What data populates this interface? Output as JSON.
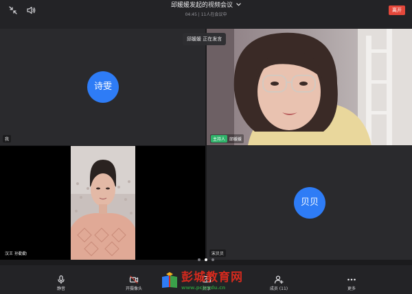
{
  "header": {
    "meeting_title": "邱媛媛发起的视频会议",
    "meeting_subtitle": "04:45 | 11人在会议中",
    "leave_label": "离开",
    "icons": [
      "collapse-icon",
      "speaker-icon",
      "chevron-down-icon"
    ]
  },
  "speaking_indicator": "邱媛媛 正在发言",
  "participants": {
    "me": {
      "avatar_text": "诗雯",
      "name": "我"
    },
    "host": {
      "badge": "主持人",
      "name": "邱媛媛"
    },
    "sunqinqin": {
      "name": "汉王 孙勤勤"
    },
    "songbeibei": {
      "avatar_text": "贝贝",
      "name": "宋贝贝"
    }
  },
  "pagination": {
    "total": 3,
    "current": 2
  },
  "toolbar": {
    "mute_label": "静音",
    "camera_label": "开摄像头",
    "share_label": "共享",
    "members_label": "成员 (11)",
    "more_label": "更多"
  },
  "watermark": {
    "text": "彭城教育网",
    "url": "www.pcjyedu.cn"
  },
  "colors": {
    "accent_blue": "#2e7cf6",
    "leave_red": "#e5483b",
    "host_green": "#2fb36a"
  }
}
